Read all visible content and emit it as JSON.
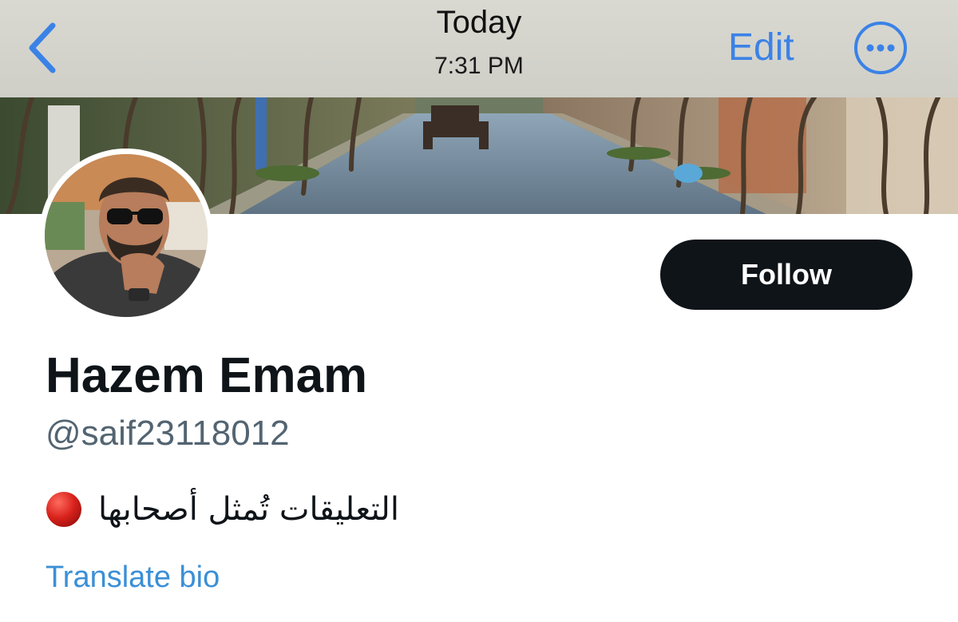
{
  "navbar": {
    "title": "Today",
    "subtitle": "7:31 PM",
    "edit_label": "Edit",
    "back_icon": "chevron-left-icon",
    "more_icon": "ellipsis-circle-icon"
  },
  "profile": {
    "display_name": "Hazem Emam",
    "handle": "@saif23118012",
    "bio_emoji": "red-circle-icon",
    "bio_text": "التعليقات تُمثل أصحابها",
    "translate_label": "Translate bio",
    "follow_label": "Follow"
  },
  "colors": {
    "accent": "#3b82e6",
    "follow_bg": "#0f1419",
    "handle_text": "#536471",
    "link": "#3b8fd6",
    "navbar_bg": "#d4d4cd"
  }
}
